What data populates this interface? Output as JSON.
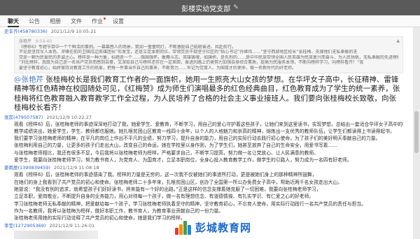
{
  "window": {
    "title": "彭楼实幼党支部"
  },
  "tabs": [
    {
      "label": "聊天"
    },
    {
      "label": "公告"
    },
    {
      "label": "相册"
    },
    {
      "label": "文件"
    },
    {
      "label": "作业"
    },
    {
      "label": "设置"
    }
  ],
  "messages": [
    {
      "sender": "史丰齐(458780336)",
      "time": "2021/12/9 10:05:21",
      "quote": {
        "author": "张艳芹",
        "time": "9:54:40",
        "lines": [
          "《榜样6》专题节目中一个个鲜活的事例，一幕幕感人的场景，筑如一盏盏明灯，不断激励自己砥砺奋进、共赴前行。",
          "不论是坚持军人本色、冲锋在前的卫国戍边英雄团长“祁发宝，还是立足本职岗位，带领党员干部坚守社区的“贴心书记”孙继伟……”坚守西部地区校长”张桂梅，支撑他们无私奉献的无",
          "党是一颗为民爱民的赤诚之心。榜样是一种力量，标题是一个……强国强怀，敢舞斗志，英雄铸魂，如旗帜，是先烈的……是中华民族带领全国人民英雄为民族复兴而奋斗、为人民扬帆，无私奉献的先进榜样，……",
          "“刘比榜样，我既为自己是一名共产党员而感到自豪，又深知自己与榜样还存在一定差距，奋进的路上仍需努力加强自身综合素质，提高为民服务本领，不断向榜样学习，向榜样看齐！”我",
          "要坚守教育初心，始终保持对教育工作的热爱，把每一件事当作自己的事来，不断努力……牢记为党育人、为国育才的使命，做一名新时代的好老师。"
        ]
      },
      "reply": "张桂梅校长是我们教育工作者的一面旗帜，她用一生照亮大山女孩的梦想。在华坪女子高中，长征精神、雷锋精神等红色精神在校园随处可见，《红梅赞》成为师生们演唱最多的红色经典曲目，红色教育成为了学生的统一素养，张桂梅将红色教育融入教育教学工作全过程，为人民培养了合格的社会主义事业接班人。我们要向张桂梅校长致敬，向张桂梅校长看齐！",
      "reply_to": "@张艳芹"
    },
    {
      "sender": "张蕊(479507587)",
      "time": "2021/12/9 10:22:27",
      "lines": [
        "观看《榜样6》后，张桂梅老师的事迹深深地打动了我，她爱学生、爱教育，不断学习，用自己的爱心守护着这些孩子，让她们来到这里读书，实现梦想，总结出一套适合华坪女子高中的教育管理模式，",
        "教学成绩突出，她爱学生，学生、教师都信服她。她扎根贫困山区教育一线四十余年，以个人的人格魅力和崇高的精神，熔炼出一支优秀的教师队伍，让学生们都读得上书读得起书，",
        "我们要学习张桂梅老师的精神，在平凡的岗位上作出不平凡的业绩，努力学习，提升自身的能力，用自己的实际行动去践行初心使命，为了孩子们的美好明天奉献自己的力量。",
        "张桂梅利用自己的力量，让更多的孩子们走出大山，改变自己的命运，她在学校里以身作则，为了学生们，她甚至放弃了自己的生命安全，用爱书写着……",
        "与张桂梅老师相比，我还有很多不足，今后我将以张桂梅老师为榜样，严格要求自己，不断学习提高，努力做一名让党放心、让人民满意的教师。",
        "爱学生，我要向张桂梅老师学习，努力教书育人，为党育人、为国育才，立足本职岗位，全身心投入教育教学工作，做学生的引路人，努力成为一名四有好老师。"
      ]
    },
    {
      "sender": "姜雨辰(1390839459)",
      "time": "2021/12/9 11:08:18",
      "lines": [
        "观看《榜样6》后，张桂梅老师的事迹感染了我。榜样的力量是无穷的，这一次我不仅被她们的事迹所打动，更是被她们身上的那种精神所鼓舞，",
        "在她们的身上我看到了共产党员的初心和使命。张桂梅老师二十多年来，扎根贫困山区，创办了全国第一所公办免费女子高中，帮助近两千名女孩走出大山，",
        "她曾说：“我没有别的追求，就希望孩子们好好读书，将来能有一个好的出路。”正是这样的信念支撑着她克服了一切困难，我要向张桂梅老师学习，",
        "立足本职，爱岗敬业，不断提升自身的业务能力，用心对待每一个孩子，做一名有理想信念、有道德情操、有扎实学识、有仁爱之心的好老师。",
        "学习张桂梅老师无私奉献的精神，把爱献给每一个孩子，学习张桂梅老师执着坚守的精神，坚守教育初心，不忘育人使命，用实际行动践行一名共产党员的责任与担当。",
        "作为一名教师，我将以张桂梅为榜样，做好本职工作，教书育人，为教育事业贡献自己的一份力量。",
        "张桂梅老师用她的实际行动诠释了共产党员的初心和使命，她是我们学习的榜样。"
      ]
    },
    {
      "sender": "李莹(1272905369)",
      "time": "2021/12/9 11:26:01"
    }
  ],
  "watermark": {
    "text": "彭城教育网"
  }
}
